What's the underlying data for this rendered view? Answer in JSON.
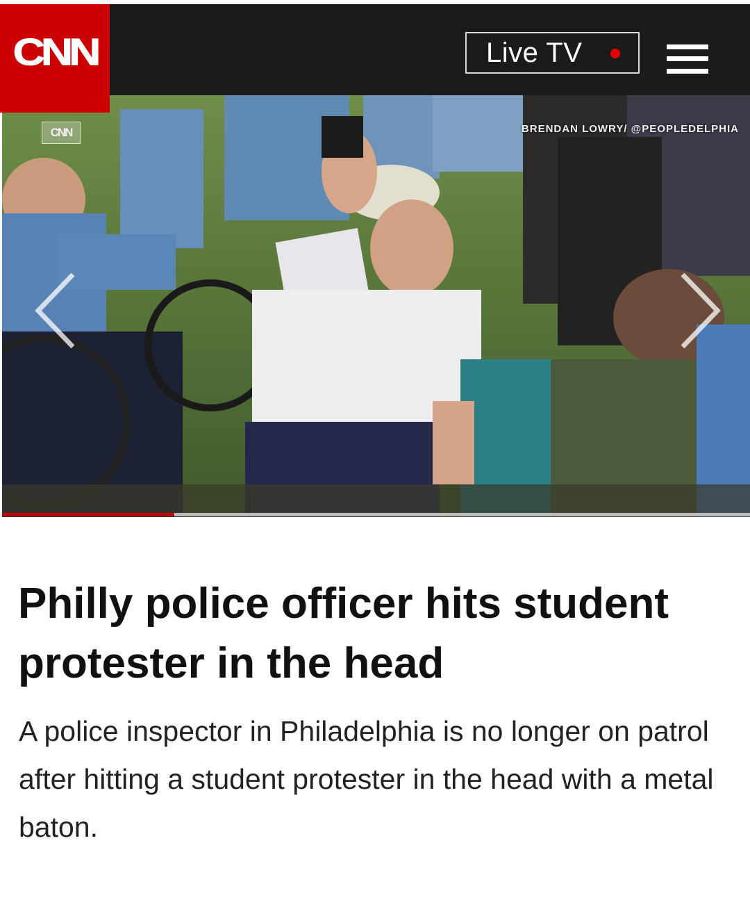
{
  "header": {
    "logo_text": "CNN",
    "live_tv_label": "Live TV",
    "menu_icon": "hamburger-menu-icon"
  },
  "media": {
    "corner_bug": "CNN",
    "credit": "BRENDAN LOWRY/ @PEOPLEDELPHIA",
    "prev_icon": "chevron-left-icon",
    "next_icon": "chevron-right-icon",
    "progress_fraction": 0.23
  },
  "article": {
    "headline": "Philly police officer hits student protester in the head",
    "summary": "A police inspector in Philadelphia is no longer on patrol after hitting a student protester in the head with a metal baton."
  },
  "colors": {
    "brand_red": "#cc0000",
    "header_bg": "#1b1b1b",
    "live_dot": "#e10000",
    "progress": "#c20000"
  }
}
